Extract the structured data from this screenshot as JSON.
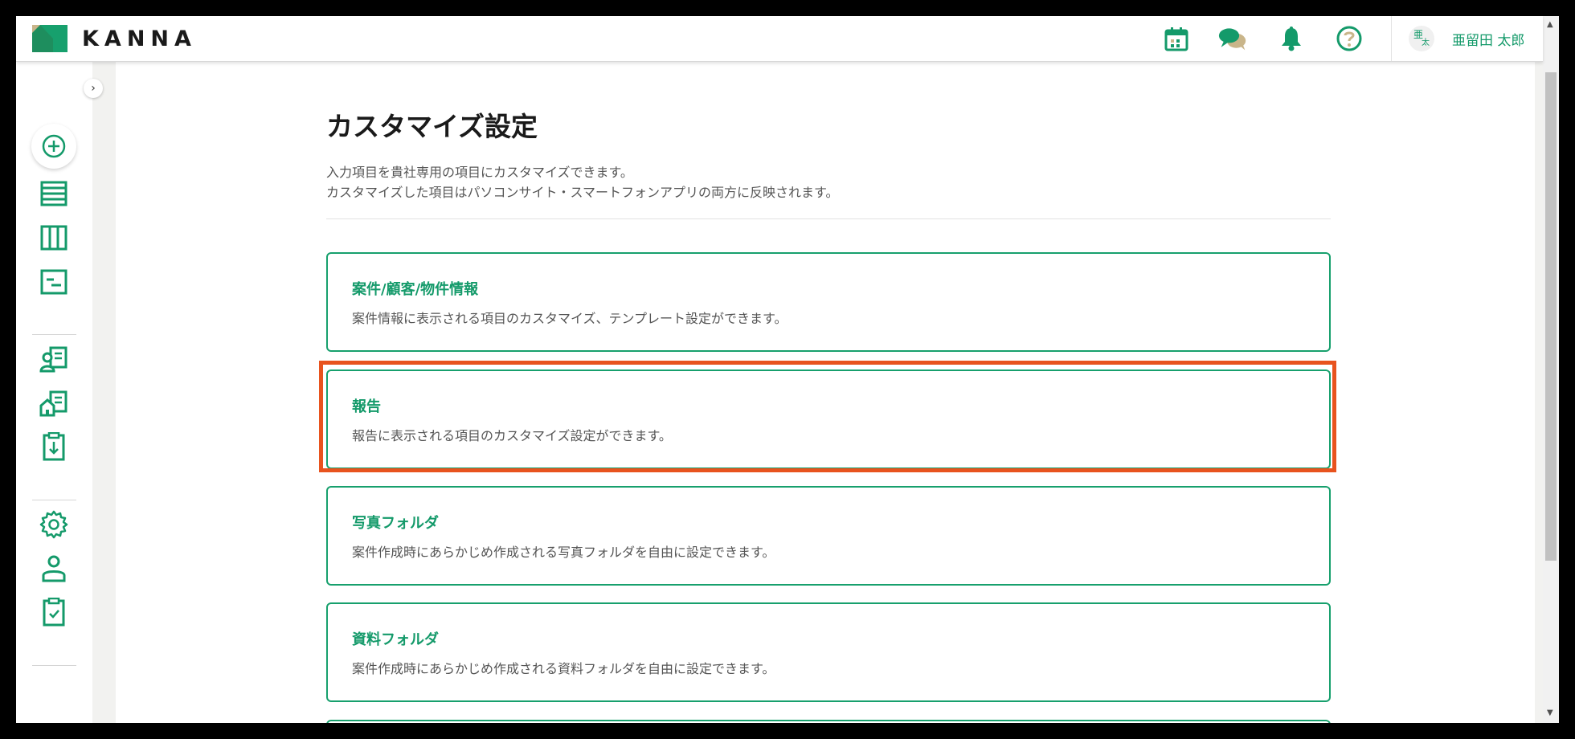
{
  "colors": {
    "brand": "#149a6a",
    "highlight": "#e8531e",
    "logo_green": "#17a06d",
    "logo_beige": "#c9b58a"
  },
  "header": {
    "logo_text": "KANNA",
    "icons": [
      "calendar-icon",
      "chat-icon",
      "bell-icon",
      "help-icon"
    ],
    "avatar_top": "亜",
    "avatar_bottom": "太",
    "username": "亜留田 太郎"
  },
  "sidebar": {
    "toggle_glyph": "›",
    "items": [
      "add-icon",
      "list-icon",
      "board-icon",
      "gantt-icon",
      "customer-icon",
      "property-icon",
      "download-icon",
      "settings-icon",
      "user-icon",
      "checklist-icon"
    ]
  },
  "page": {
    "title": "カスタマイズ設定",
    "desc_line1": "入力項目を貴社専用の項目にカスタマイズできます。",
    "desc_line2": "カスタマイズした項目はパソコンサイト・スマートフォンアプリの両方に反映されます。"
  },
  "cards": [
    {
      "title": "案件/顧客/物件情報",
      "desc": "案件情報に表示される項目のカスタマイズ、テンプレート設定ができます。"
    },
    {
      "title": "報告",
      "desc": "報告に表示される項目のカスタマイズ設定ができます。"
    },
    {
      "title": "写真フォルダ",
      "desc": "案件作成時にあらかじめ作成される写真フォルダを自由に設定できます。"
    },
    {
      "title": "資料フォルダ",
      "desc": "案件作成時にあらかじめ作成される資料フォルダを自由に設定できます。"
    }
  ],
  "scrollbar": {
    "up_arrow": "▲",
    "down_arrow": "▼"
  }
}
